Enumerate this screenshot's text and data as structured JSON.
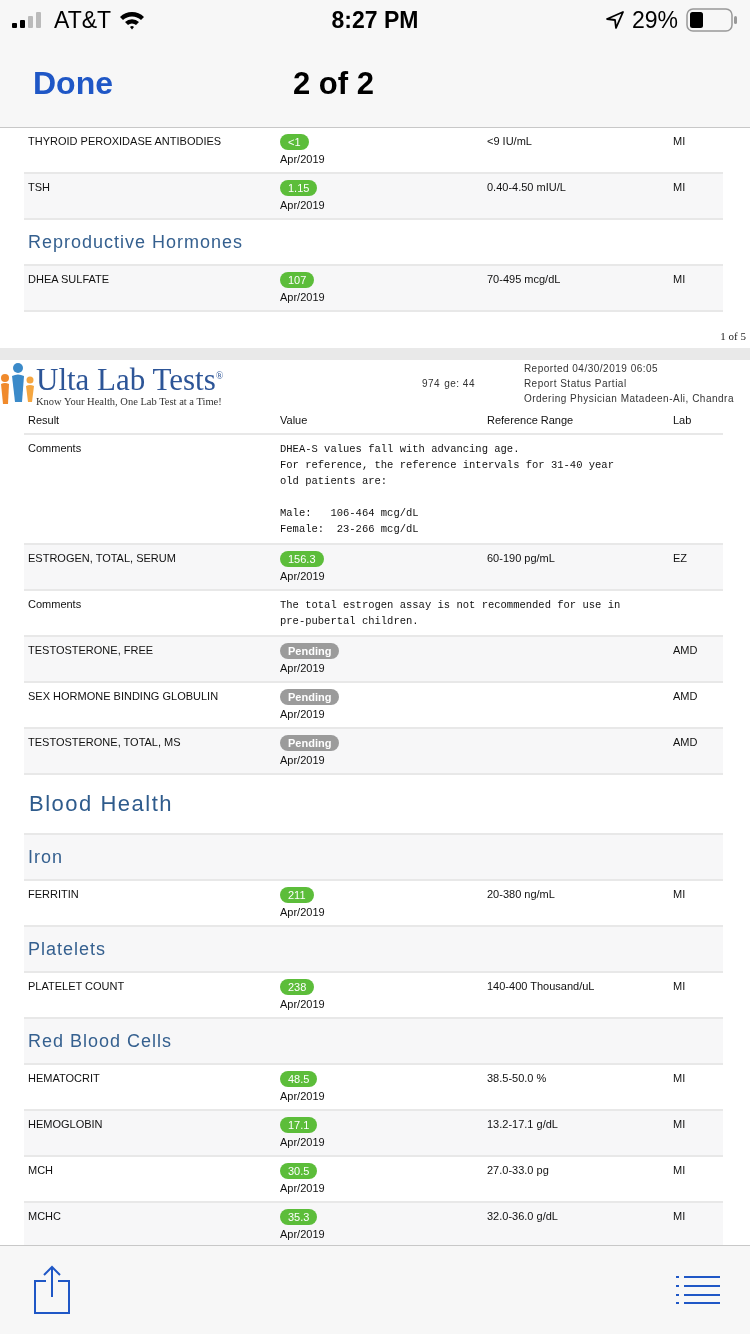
{
  "status_bar": {
    "carrier": "AT&T",
    "time": "8:27 PM",
    "battery": "29%"
  },
  "nav": {
    "done": "Done",
    "title": "2 of 2"
  },
  "page_1": {
    "rows": [
      {
        "kind": "result",
        "name": "THYROID PEROXIDASE ANTIBODIES",
        "value": "<1",
        "pending": false,
        "date": "Apr/2019",
        "range": "<9 IU/mL",
        "lab": "MI"
      },
      {
        "kind": "result",
        "name": "TSH",
        "value": "1.15",
        "pending": false,
        "date": "Apr/2019",
        "range": "0.40-4.50 mIU/L",
        "lab": "MI"
      },
      {
        "kind": "subsection",
        "title": "Reproductive Hormones"
      },
      {
        "kind": "result",
        "name": "DHEA SULFATE",
        "value": "107",
        "pending": false,
        "date": "Apr/2019",
        "range": "70-495 mcg/dL",
        "lab": "MI"
      }
    ],
    "page_number": "1 of 5"
  },
  "page_2": {
    "logo": {
      "name": "Ulta Lab Tests$^{®}$",
      "tagline": "Know Your Health, One Lab Test at a Time!"
    },
    "patient": {
      "fragment_1": "974",
      "fragment_2": "ge: 44"
    },
    "report": [
      "Reported 04/30/2019 06:05",
      "Report Status Partial",
      "Ordering Physician Matadeen-Ali, Chandra"
    ],
    "columns": [
      "Result",
      "Value",
      "Reference Range",
      "Lab"
    ],
    "rows": [
      {
        "kind": "comment",
        "name": "Comments",
        "paragraphs": [
          [
            "DHEA-S values fall with advancing age.",
            "For reference, the reference intervals for 31-40 year",
            "old patients are:"
          ],
          [
            "Male:   106-464 mcg/dL",
            "Female:  23-266 mcg/dL"
          ]
        ]
      },
      {
        "kind": "result",
        "name": "ESTROGEN, TOTAL, SERUM",
        "value": "156.3",
        "pending": false,
        "date": "Apr/2019",
        "range": "60-190 pg/mL",
        "lab": "EZ"
      },
      {
        "kind": "comment",
        "name": "Comments",
        "paragraphs": [
          [
            "The total estrogen assay is not recommended for use in",
            "pre-pubertal children."
          ]
        ]
      },
      {
        "kind": "result",
        "name": "TESTOSTERONE, FREE",
        "value": "Pending",
        "pending": true,
        "date": "Apr/2019",
        "lab": "AMD"
      },
      {
        "kind": "result",
        "name": "SEX HORMONE BINDING GLOBULIN",
        "value": "Pending",
        "pending": true,
        "date": "Apr/2019",
        "lab": "AMD"
      },
      {
        "kind": "result",
        "name": "TESTOSTERONE, TOTAL, MS",
        "value": "Pending",
        "pending": true,
        "date": "Apr/2019",
        "lab": "AMD"
      },
      {
        "kind": "section",
        "title": "Blood Health"
      },
      {
        "kind": "subsection",
        "title": "Iron"
      },
      {
        "kind": "result",
        "name": "FERRITIN",
        "value": "211",
        "pending": false,
        "date": "Apr/2019",
        "range": "20-380 ng/mL",
        "lab": "MI"
      },
      {
        "kind": "subsection",
        "title": "Platelets"
      },
      {
        "kind": "result",
        "name": "PLATELET COUNT",
        "value": "238",
        "pending": false,
        "date": "Apr/2019",
        "range": "140-400 Thousand/uL",
        "lab": "MI"
      },
      {
        "kind": "subsection",
        "title": "Red Blood Cells"
      },
      {
        "kind": "result",
        "name": "HEMATOCRIT",
        "value": "48.5",
        "pending": false,
        "date": "Apr/2019",
        "range": "38.5-50.0 %",
        "lab": "MI"
      },
      {
        "kind": "result",
        "name": "HEMOGLOBIN",
        "value": "17.1",
        "pending": false,
        "date": "Apr/2019",
        "range": "13.2-17.1 g/dL",
        "lab": "MI"
      },
      {
        "kind": "result",
        "name": "MCH",
        "value": "30.5",
        "pending": false,
        "date": "Apr/2019",
        "range": "27.0-33.0 pg",
        "lab": "MI"
      },
      {
        "kind": "result",
        "name": "MCHC",
        "value": "35.3",
        "pending": false,
        "date": "Apr/2019",
        "range": "32.0-36.0 g/dL",
        "lab": "MI"
      }
    ]
  }
}
